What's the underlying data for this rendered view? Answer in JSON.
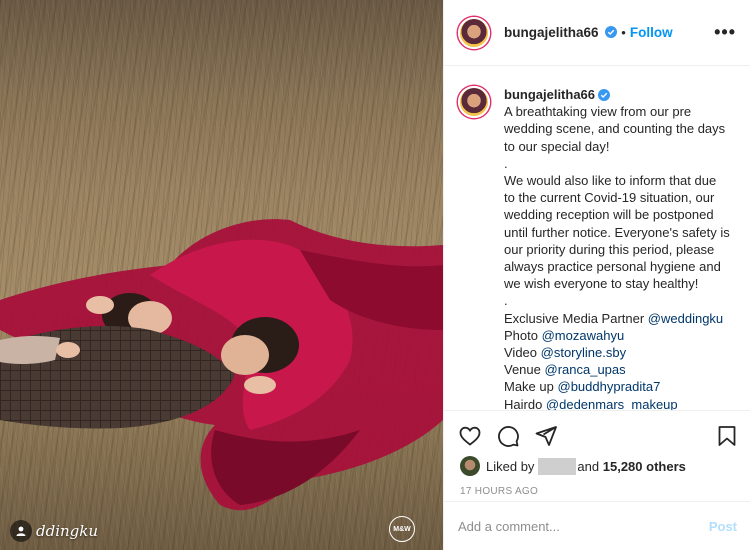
{
  "post": {
    "username": "bungajelitha66",
    "verified": true,
    "separator": "•",
    "follow_label": "Follow",
    "more_label": "•••"
  },
  "caption": {
    "username": "bungajelitha66",
    "paragraph1": "A breathtaking view from our pre wedding scene, and counting the days to our special day!",
    "dot1": ".",
    "paragraph2": "We would also like to inform that due to the current Covid-19 situation, our wedding reception will be postponed until further notice. Everyone's safety is our priority during this period, please always practice personal hygiene and we wish everyone to stay healthy!",
    "dot2": ".",
    "credits": [
      {
        "label": "Exclusive Media Partner",
        "handle": "@weddingku"
      },
      {
        "label": "Photo",
        "handle": "@mozawahyu"
      },
      {
        "label": "Video",
        "handle": "@storyline.sby"
      },
      {
        "label": "Venue",
        "handle": "@ranca_upas"
      },
      {
        "label": "Make up",
        "handle": "@buddhypradita7"
      },
      {
        "label": "Hairdo",
        "handle": "@dedenmars_makeup"
      }
    ]
  },
  "likes": {
    "prefix": "Liked by",
    "conjunction": "and",
    "count_text": "15,280 others"
  },
  "timestamp": "17 HOURS AGO",
  "comment_box": {
    "placeholder": "Add a comment...",
    "post_label": "Post"
  },
  "photo": {
    "watermark_text": "ddingku",
    "logo_text": "M&W"
  },
  "colors": {
    "accent": "#0095f6",
    "mention": "#00376b",
    "post_disabled": "#b2dffc",
    "dress": "#b3123f"
  },
  "icons": [
    "heart-icon",
    "comment-icon",
    "share-icon",
    "bookmark-icon",
    "verified-icon",
    "more-icon",
    "user-icon"
  ]
}
